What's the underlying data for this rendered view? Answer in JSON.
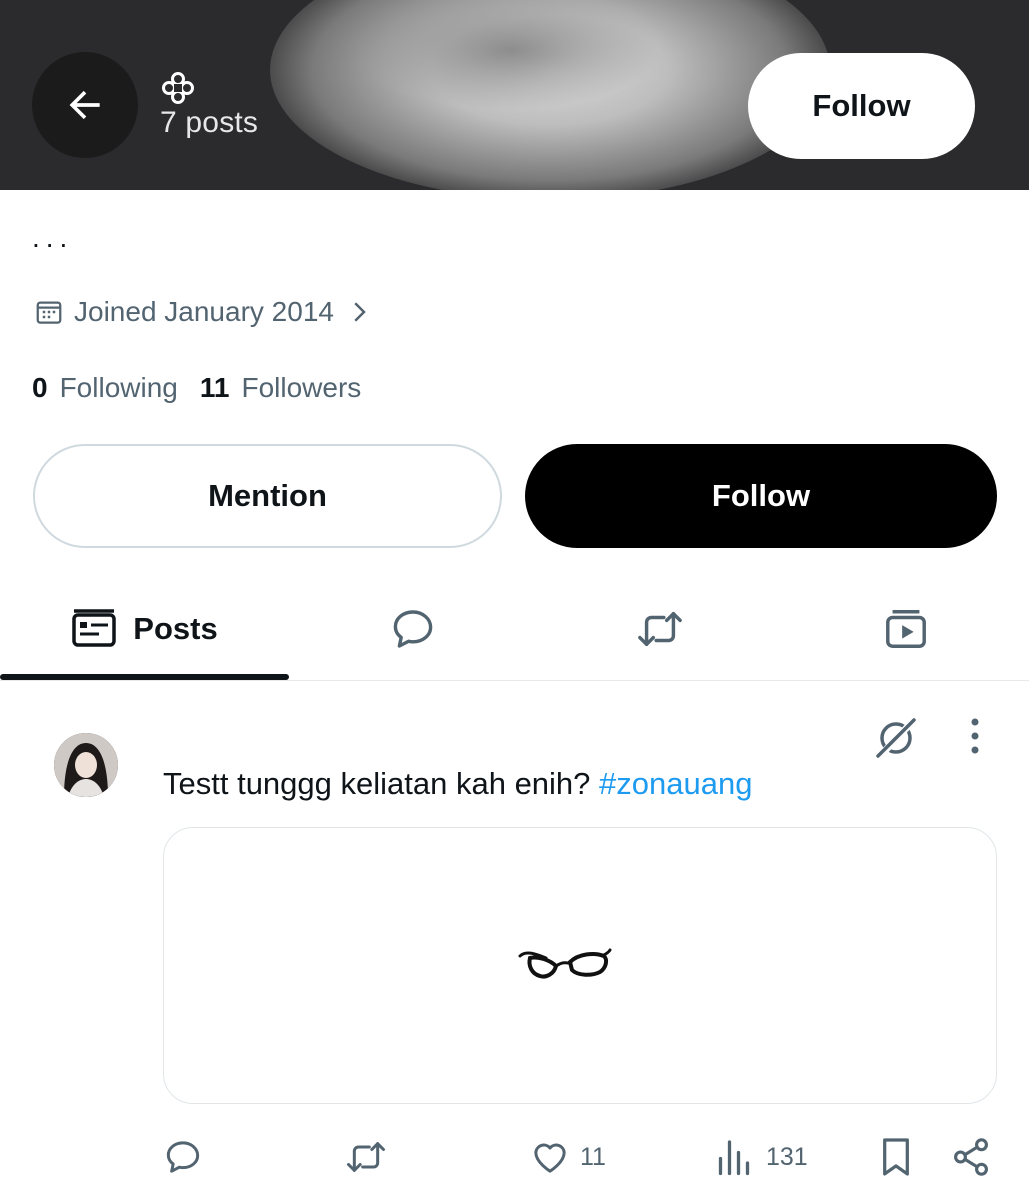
{
  "header": {
    "posts_count": "7 posts",
    "follow_label": "Follow",
    "icons": {
      "back": "arrow-left-icon",
      "name_badge": "four-point-star-icon"
    }
  },
  "profile": {
    "bio": "...",
    "joined": "Joined January 2014",
    "following_count": "0",
    "following_label": "Following",
    "followers_count": "11",
    "followers_label": "Followers"
  },
  "actions": {
    "mention_label": "Mention",
    "follow_label": "Follow"
  },
  "tabs": [
    {
      "label": "Posts",
      "icon": "posts-icon",
      "selected": true
    },
    {
      "label": "",
      "icon": "replies-bubble-icon"
    },
    {
      "label": "",
      "icon": "repost-icon"
    },
    {
      "label": "",
      "icon": "media-video-icon"
    }
  ],
  "tweet": {
    "text": "Testt tunggg keliatan kah enih? ",
    "hashtag": "#zonauang",
    "media": "glasses-image",
    "reply_count": "",
    "repost_count": "",
    "like_count": "11",
    "view_count": "131"
  },
  "colors": {
    "accent": "#1d9bf0",
    "text": "#0f1419",
    "muted": "#536471",
    "border": "#cfd9de"
  }
}
